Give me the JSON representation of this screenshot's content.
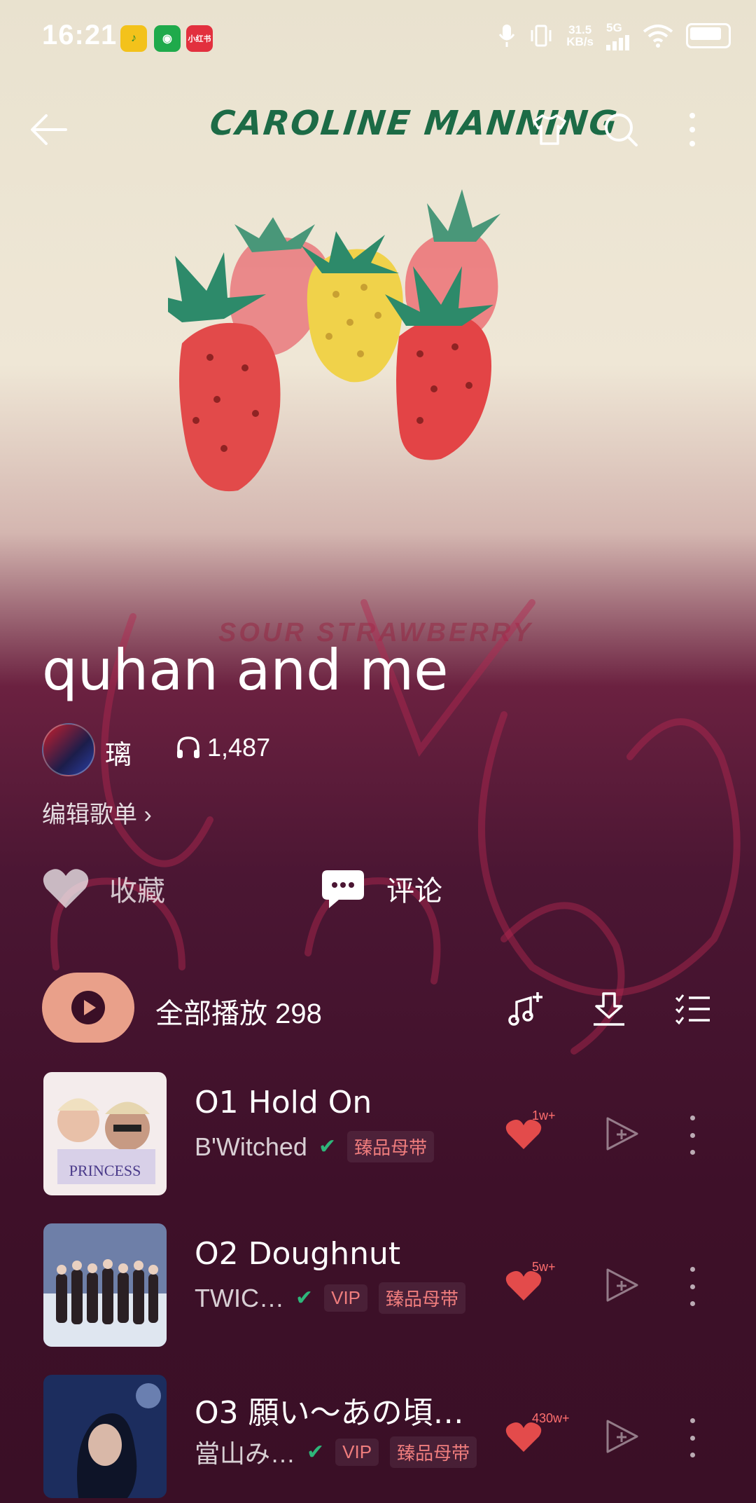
{
  "status_bar": {
    "time": "16:21",
    "net_speed_value": "31.5",
    "net_speed_unit": "KB/s",
    "net_type": "5G",
    "badges": [
      "微信读书",
      "WeChat",
      "小红书"
    ]
  },
  "header": {
    "album_script": "CAROLINE MANNING"
  },
  "cover": {
    "faded_text": "SOUR STRAWBERRY"
  },
  "playlist": {
    "title": "quhan and me",
    "owner": "璃",
    "listen_count": "1,487",
    "edit_label": "编辑歌单",
    "fav_label": "收藏",
    "comment_label": "评论",
    "play_all_label": "全部播放",
    "song_count": "298"
  },
  "songs": [
    {
      "title": "O1 Hold On",
      "artist": "B'Witched",
      "vip": "",
      "quality": "臻品母带",
      "likes": "1w+"
    },
    {
      "title": "O2 Doughnut",
      "artist": "TWIC…",
      "vip": "VIP",
      "quality": "臻品母带",
      "likes": "5w+"
    },
    {
      "title": "O3 願い～あの頃…",
      "artist": "當山み…",
      "vip": "VIP",
      "quality": "臻品母带",
      "likes": "430w+"
    }
  ],
  "colors": {
    "accent": "#e9a08a",
    "verified": "#2eb67a",
    "quality_tag": "#ef7d7d",
    "like": "#e34b4b"
  }
}
